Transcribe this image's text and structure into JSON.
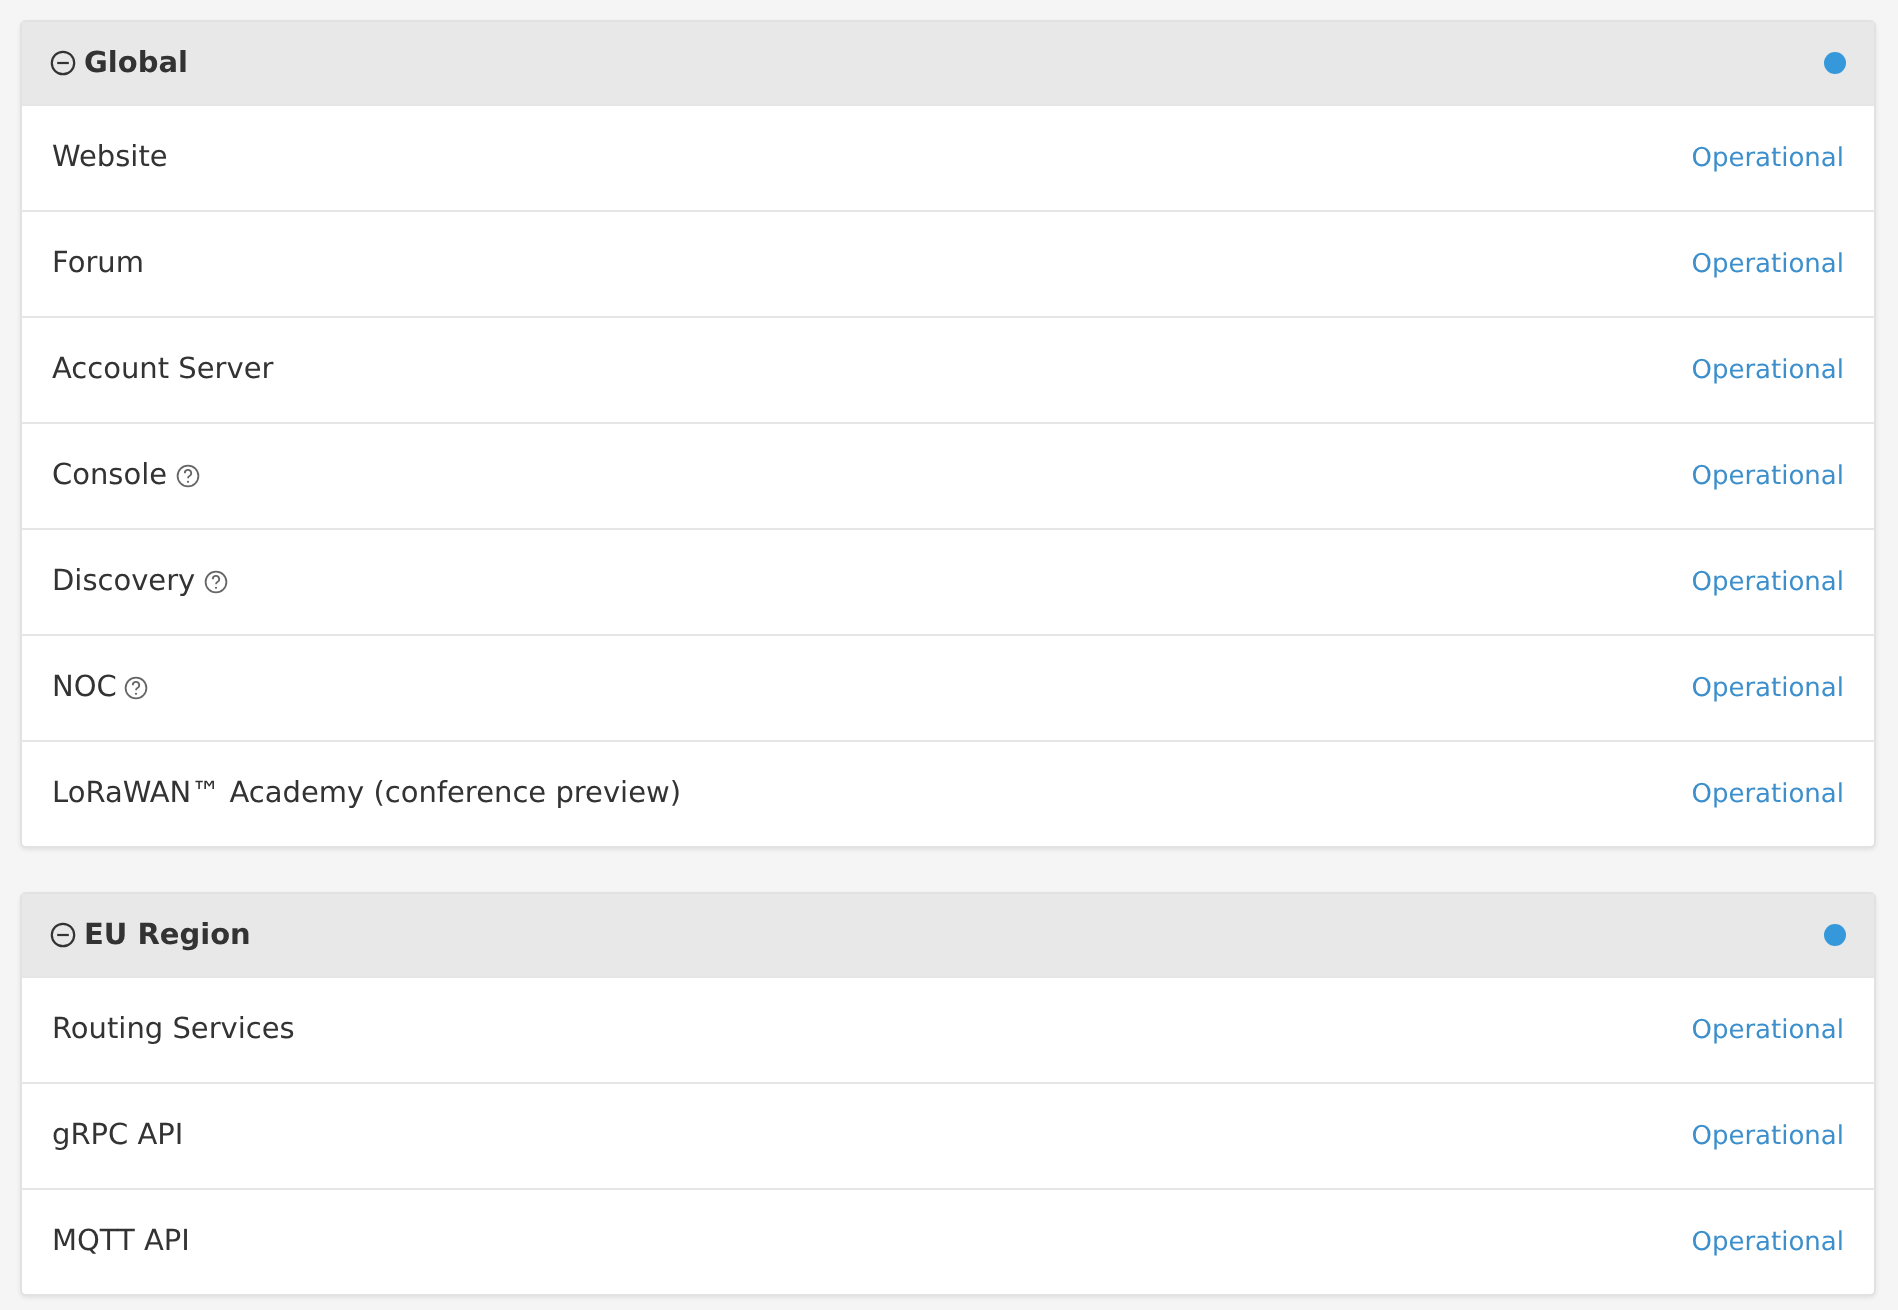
{
  "groups": [
    {
      "title": "Global",
      "expanded": true,
      "color": "#3498db",
      "components": [
        {
          "name": "Website",
          "help": false,
          "status": "Operational"
        },
        {
          "name": "Forum",
          "help": false,
          "status": "Operational"
        },
        {
          "name": "Account Server",
          "help": false,
          "status": "Operational"
        },
        {
          "name": "Console",
          "help": true,
          "status": "Operational"
        },
        {
          "name": "Discovery",
          "help": true,
          "status": "Operational"
        },
        {
          "name": "NOC",
          "help": true,
          "status": "Operational"
        },
        {
          "name": "LoRaWAN™ Academy (conference preview)",
          "help": false,
          "status": "Operational"
        }
      ]
    },
    {
      "title": "EU Region",
      "expanded": true,
      "color": "#3498db",
      "components": [
        {
          "name": "Routing Services",
          "help": false,
          "status": "Operational"
        },
        {
          "name": "gRPC API",
          "help": false,
          "status": "Operational"
        },
        {
          "name": "MQTT API",
          "help": false,
          "status": "Operational"
        }
      ]
    }
  ]
}
